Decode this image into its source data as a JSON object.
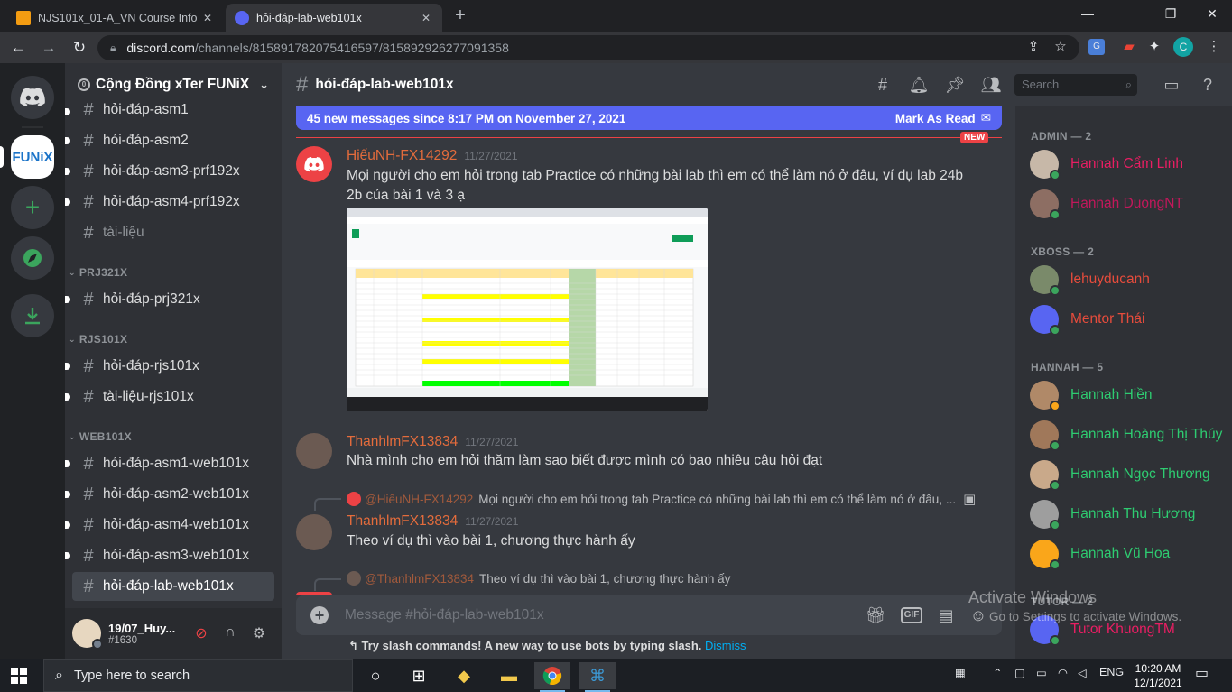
{
  "browser": {
    "tabs": [
      {
        "title": "NJS101x_01-A_VN Course Info | F"
      },
      {
        "title": "hỏi-đáp-lab-web101x"
      }
    ],
    "url_domain": "discord.com",
    "url_path": "/channels/815891782075416597/815892926277091358"
  },
  "servers": {
    "funix_label": "FUNiX"
  },
  "guild": {
    "name": "Cộng Đồng xTer FUNiX",
    "channels": [
      {
        "name": "hỏi-đáp-asm1"
      },
      {
        "name": "hỏi-đáp-asm2"
      },
      {
        "name": "hỏi-đáp-asm3-prf192x"
      },
      {
        "name": "hỏi-đáp-asm4-prf192x"
      },
      {
        "name": "tài-liệu"
      }
    ],
    "categories": [
      {
        "name": "PRJ321X",
        "channels": [
          {
            "name": "hỏi-đáp-prj321x"
          }
        ]
      },
      {
        "name": "RJS101X",
        "channels": [
          {
            "name": "hỏi-đáp-rjs101x"
          },
          {
            "name": "tài-liệu-rjs101x"
          }
        ]
      },
      {
        "name": "WEB101X",
        "channels": [
          {
            "name": "hỏi-đáp-asm1-web101x"
          },
          {
            "name": "hỏi-đáp-asm2-web101x"
          },
          {
            "name": "hỏi-đáp-asm4-web101x"
          },
          {
            "name": "hỏi-đáp-asm3-web101x"
          },
          {
            "name": "hỏi-đáp-lab-web101x"
          }
        ]
      }
    ]
  },
  "user": {
    "name": "19/07_Huy...",
    "discriminator": "#1630"
  },
  "channel": {
    "title": "hỏi-đáp-lab-web101x",
    "search_placeholder": "Search"
  },
  "new_messages": {
    "text": "45 new messages since 8:17 PM on November 27, 2021",
    "mark_label": "Mark As Read",
    "new_tag": "NEW"
  },
  "messages": [
    {
      "author": "HiếuNH-FX14292",
      "timestamp": "11/27/2021",
      "line1": "Mọi người cho em hỏi trong tab Practice có những bài lab thì em có thể làm nó ở đâu, ví dụ lab 24b",
      "line2": "2b của bài 1 và 3 ạ"
    },
    {
      "author": "ThanhlmFX13834",
      "timestamp": "11/27/2021",
      "text": "Nhà mình cho em hỏi thăm làm sao biết được mình có bao nhiêu câu hỏi đạt"
    },
    {
      "reply_author": "@HiếuNH-FX14292",
      "reply_text": "Mọi người cho em hỏi trong tab Practice có những bài lab thì em có thể làm nó ở đâu, ...",
      "author": "ThanhlmFX13834",
      "timestamp": "11/27/2021",
      "text": "Theo ví dụ thì vào bài 1, chương thực hành ấy"
    },
    {
      "reply_author": "@ThanhlmFX13834",
      "reply_text": "Theo ví dụ thì vào bài 1, chương thực hành ấy"
    }
  ],
  "composer": {
    "placeholder": "Message #hỏi-đáp-lab-web101x",
    "gif_label": "GIF",
    "tip": "Try slash commands! A new way to use bots by typing slash.",
    "dismiss": "Dismiss"
  },
  "members": {
    "groups": [
      {
        "title": "ADMIN — 2",
        "members": [
          "Hannah Cẩm Linh",
          "Hannah DuongNT"
        ]
      },
      {
        "title": "XBOSS — 2",
        "members": [
          "lehuyducanh",
          "Mentor Thái"
        ]
      },
      {
        "title": "HANNAH — 5",
        "members": [
          "Hannah Hiền",
          "Hannah Hoàng Thị Thúy",
          "Hannah Ngọc Thương",
          "Hannah Thu Hương",
          "Hannah Vũ Hoa"
        ]
      },
      {
        "title": "TUTOR — 2",
        "members": [
          "Tutor KhuongTM"
        ]
      }
    ]
  },
  "watermark": {
    "line1": "Activate Windows",
    "line2": "Go to Settings to activate Windows."
  },
  "taskbar": {
    "search_placeholder": "Type here to search",
    "lang": "ENG",
    "time": "10:20 AM",
    "date": "12/1/2021"
  }
}
